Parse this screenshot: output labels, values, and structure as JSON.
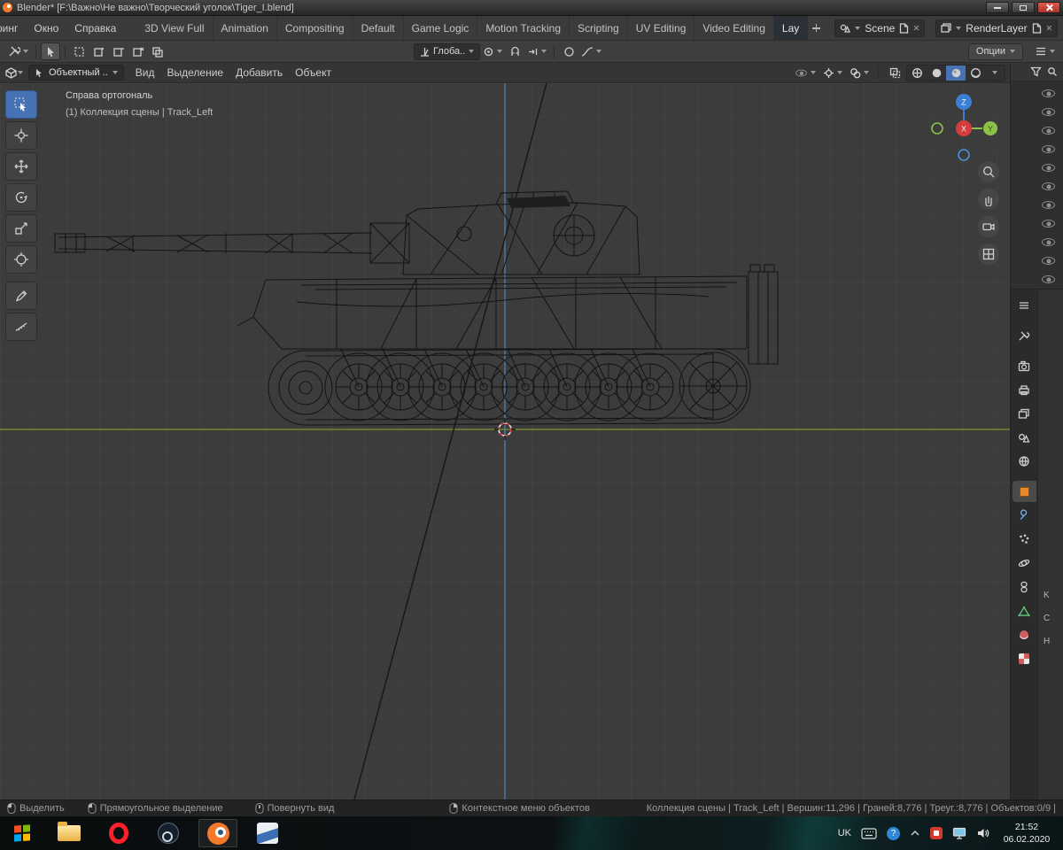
{
  "colors": {
    "accent_blue": "#4772b3",
    "object_orange": "#e8872b",
    "axis_x_red": "#d43b3b",
    "axis_y_green": "#8bc24a",
    "axis_z_blue": "#3b7fd4",
    "close_red": "#c0443a",
    "viewport_bg": "#3c3c3c"
  },
  "window": {
    "title": "Blender* [F:\\Важно\\Не важно\\Творческий уголок\\Tiger_I.blend]"
  },
  "topbar": {
    "menus": [
      "ринг",
      "Окно",
      "Справка"
    ],
    "workspaces": [
      "3D View Full",
      "Animation",
      "Compositing",
      "Default",
      "Game Logic",
      "Motion Tracking",
      "Scripting",
      "UV Editing",
      "Video Editing",
      "Lay"
    ],
    "scene": {
      "label": "Scene"
    },
    "renderlayer": {
      "label": "RenderLayer"
    }
  },
  "toolsettings": {
    "orientation": "Глоба..",
    "options": "Опции"
  },
  "viewport": {
    "mode": "Объектный ..",
    "menus": [
      "Вид",
      "Выделение",
      "Добавить",
      "Объект"
    ],
    "view_label": "Справа ортогональ",
    "collection_label": "(1) Коллекция сцены | Track_Left",
    "gizmo": {
      "z": "Z",
      "x": "X",
      "y": "Y"
    }
  },
  "statusbar": {
    "hints": [
      "Выделить",
      "Прямоугольное выделение",
      "Повернуть вид",
      "Контекстное меню объектов"
    ],
    "stats": "Коллекция сцены | Track_Left | Вершин:11,296 | Граней:8,776 | Треуг.:8,776 | Объектов:0/9 |"
  },
  "properties": {
    "sliver_labels": [
      "K",
      "C",
      "H"
    ]
  },
  "taskbar": {
    "language": "UK",
    "help": "?",
    "time": "21:52",
    "date": "06.02.2020"
  }
}
